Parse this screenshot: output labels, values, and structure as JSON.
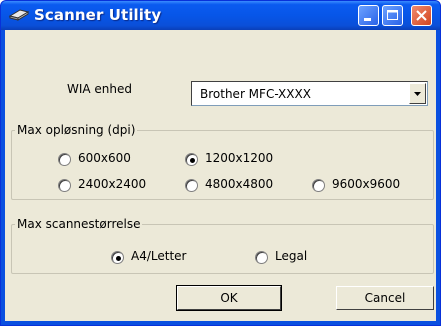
{
  "window": {
    "title": "Scanner Utility"
  },
  "wia": {
    "label": "WIA enhed",
    "selected": "Brother MFC-XXXX"
  },
  "resolution_group": {
    "legend": "Max opløsning (dpi)",
    "options": [
      "600x600",
      "1200x1200",
      "2400x2400",
      "4800x4800",
      "9600x9600"
    ],
    "selected": "1200x1200"
  },
  "size_group": {
    "legend": "Max scannestørrelse",
    "options": [
      "A4/Letter",
      "Legal"
    ],
    "selected": "A4/Letter"
  },
  "buttons": {
    "ok": "OK",
    "cancel": "Cancel"
  }
}
